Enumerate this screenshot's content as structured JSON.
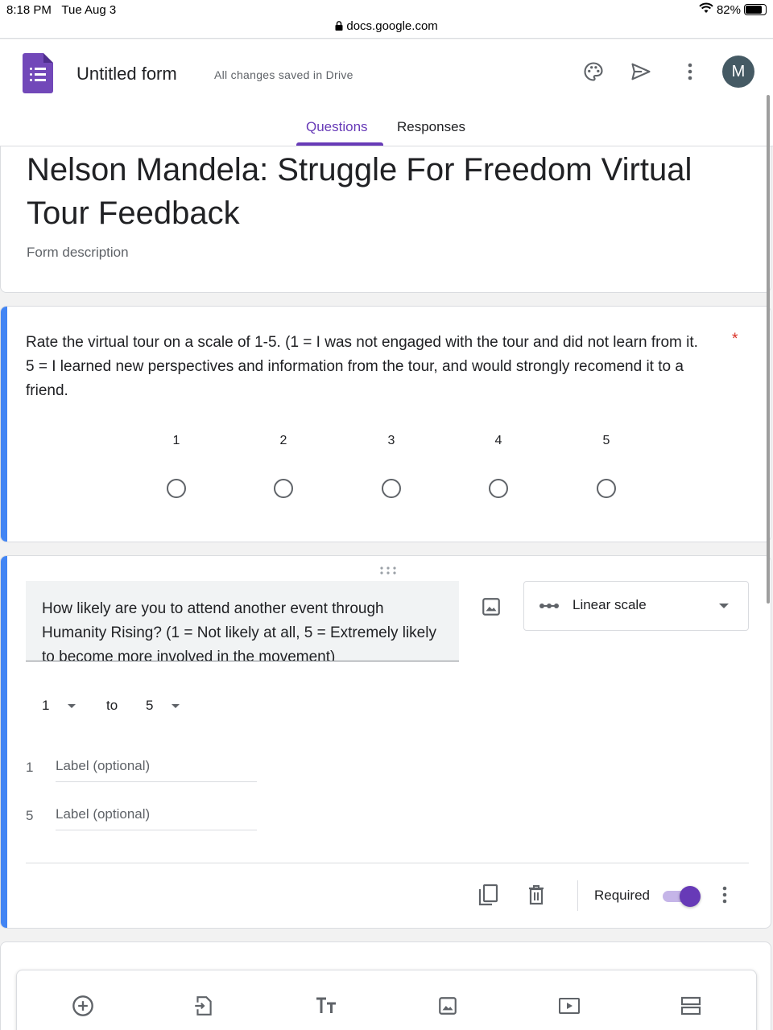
{
  "status_bar": {
    "time": "8:18 PM",
    "date": "Tue Aug 3",
    "battery": "82%",
    "battery_level": 0.82,
    "url": "docs.google.com"
  },
  "header": {
    "form_title": "Untitled form",
    "save_status": "All changes saved in Drive",
    "avatar_initial": "M",
    "icons": [
      "palette-icon",
      "send-icon",
      "more-vert-icon"
    ]
  },
  "tabs": [
    {
      "label": "Questions",
      "active": true
    },
    {
      "label": "Responses",
      "active": false
    }
  ],
  "title_card": {
    "title": "Nelson Mandela: Struggle For Freedom Virtual Tour Feedback",
    "description_placeholder": "Form description"
  },
  "question1": {
    "text": "Rate the virtual tour on a scale  of 1-5. (1 = I was not engaged with the tour and did not learn from it. 5 = I learned new perspectives and information from the tour, and would strongly recomend it to a friend.",
    "required_mark": "*",
    "scale": [
      "1",
      "2",
      "3",
      "4",
      "5"
    ]
  },
  "question2": {
    "text": "How likely are you to attend another event through Humanity Rising? (1 = Not likely at all, 5 = Extremely likely to become more involved in the movement)",
    "type_label": "Linear scale",
    "range_from": "1",
    "range_to_word": "to",
    "range_to": "5",
    "label_rows": [
      {
        "num": "1",
        "placeholder": "Label (optional)"
      },
      {
        "num": "5",
        "placeholder": "Label (optional)"
      }
    ],
    "required_label": "Required",
    "required_on": true
  },
  "toolbar": {
    "icons": [
      "add-question-icon",
      "import-questions-icon",
      "add-title-icon",
      "add-image-icon",
      "add-video-icon",
      "add-section-icon"
    ]
  },
  "colors": {
    "accent": "#673ab7",
    "focus_bar": "#4285f4",
    "required": "#d93025"
  }
}
